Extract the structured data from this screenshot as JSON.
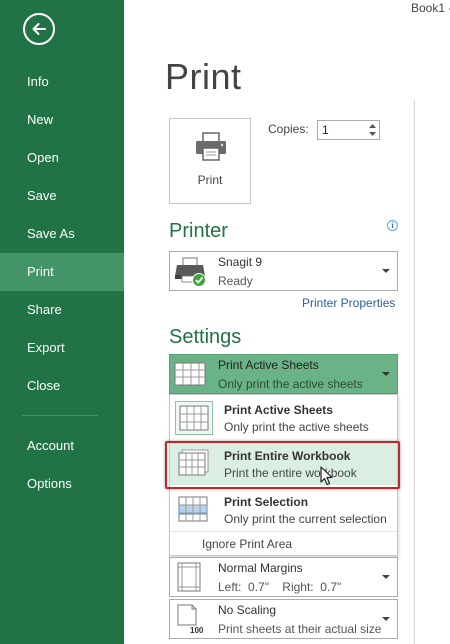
{
  "window": {
    "doc_title": "Book1 -"
  },
  "nav": {
    "items": [
      {
        "label": "Info"
      },
      {
        "label": "New"
      },
      {
        "label": "Open"
      },
      {
        "label": "Save"
      },
      {
        "label": "Save As"
      },
      {
        "label": "Print"
      },
      {
        "label": "Share"
      },
      {
        "label": "Export"
      },
      {
        "label": "Close"
      },
      {
        "label": "Account"
      },
      {
        "label": "Options"
      }
    ],
    "active": "Print"
  },
  "page": {
    "title": "Print"
  },
  "print_button": {
    "label": "Print"
  },
  "copies": {
    "label": "Copies:",
    "value": "1"
  },
  "printer": {
    "heading": "Printer",
    "name": "Snagit 9",
    "status": "Ready",
    "properties_link": "Printer Properties"
  },
  "settings": {
    "heading": "Settings",
    "selected": {
      "title": "Print Active Sheets",
      "desc": "Only print the active sheets"
    },
    "menu": [
      {
        "title": "Print Active Sheets",
        "desc": "Only print the active sheets"
      },
      {
        "title": "Print Entire Workbook",
        "desc": "Print the entire workbook"
      },
      {
        "title": "Print Selection",
        "desc": "Only print the current selection"
      }
    ],
    "ignore_print_area": "Ignore Print Area",
    "margins": {
      "title": "Normal Margins",
      "desc": "Left:  0.7\"    Right:  0.7\""
    },
    "scaling": {
      "title": "No Scaling",
      "desc": "Print sheets at their actual size",
      "icon_text": "100"
    }
  },
  "colors": {
    "nav_bg": "#217346",
    "nav_active": "#439467",
    "accent_green": "#217346",
    "dropdown_selected": "#69b386",
    "hover_outline": "#c0272d",
    "link": "#2e5f9e"
  }
}
